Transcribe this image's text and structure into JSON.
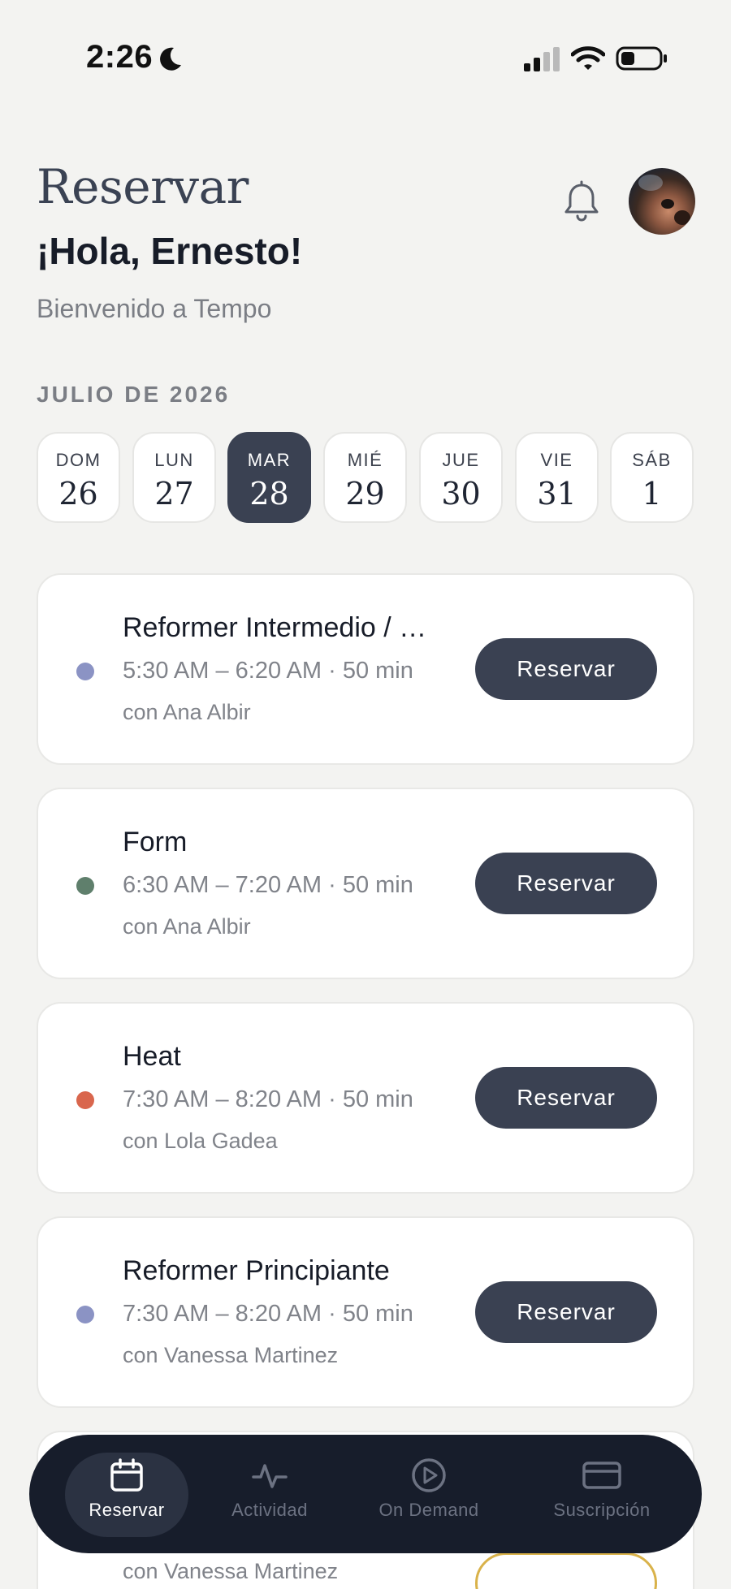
{
  "status_bar": {
    "time": "2:26"
  },
  "header": {
    "title": "Reservar",
    "greeting": "¡Hola, Ernesto!",
    "welcome": "Bienvenido a Tempo"
  },
  "calendar": {
    "month": "JULIO DE 2026",
    "days": [
      {
        "dow": "DOM",
        "num": "26",
        "selected": false
      },
      {
        "dow": "LUN",
        "num": "27",
        "selected": false
      },
      {
        "dow": "MAR",
        "num": "28",
        "selected": true
      },
      {
        "dow": "MIÉ",
        "num": "29",
        "selected": false
      },
      {
        "dow": "JUE",
        "num": "30",
        "selected": false
      },
      {
        "dow": "VIE",
        "num": "31",
        "selected": false
      },
      {
        "dow": "SÁB",
        "num": "1",
        "selected": false
      }
    ]
  },
  "classes": [
    {
      "name": "Reformer Intermedio / …",
      "time": "5:30 AM – 6:20 AM · 50 min",
      "instructor": "con Ana Albir",
      "dot_color": "#8b93c4",
      "button": "Reservar"
    },
    {
      "name": "Form",
      "time": "6:30 AM – 7:20 AM · 50 min",
      "instructor": "con Ana Albir",
      "dot_color": "#5f7f6c",
      "button": "Reservar"
    },
    {
      "name": "Heat",
      "time": "7:30 AM – 8:20 AM · 50 min",
      "instructor": "con Lola Gadea",
      "dot_color": "#d9664d",
      "button": "Reservar"
    },
    {
      "name": "Reformer Principiante",
      "time": "7:30 AM – 8:20 AM · 50 min",
      "instructor": "con Vanessa Martinez",
      "dot_color": "#8b93c4",
      "button": "Reservar"
    },
    {
      "instructor": "con Vanessa Martinez"
    }
  ],
  "nav": [
    {
      "label": "Reservar",
      "icon": "calendar-icon",
      "active": true
    },
    {
      "label": "Actividad",
      "icon": "activity-icon",
      "active": false
    },
    {
      "label": "On Demand",
      "icon": "play-circle-icon",
      "active": false
    },
    {
      "label": "Suscripción",
      "icon": "credit-card-icon",
      "active": false
    }
  ],
  "colors": {
    "accent": "#3a4152",
    "nav_bg": "#171d2b",
    "background": "#f3f3f1"
  }
}
